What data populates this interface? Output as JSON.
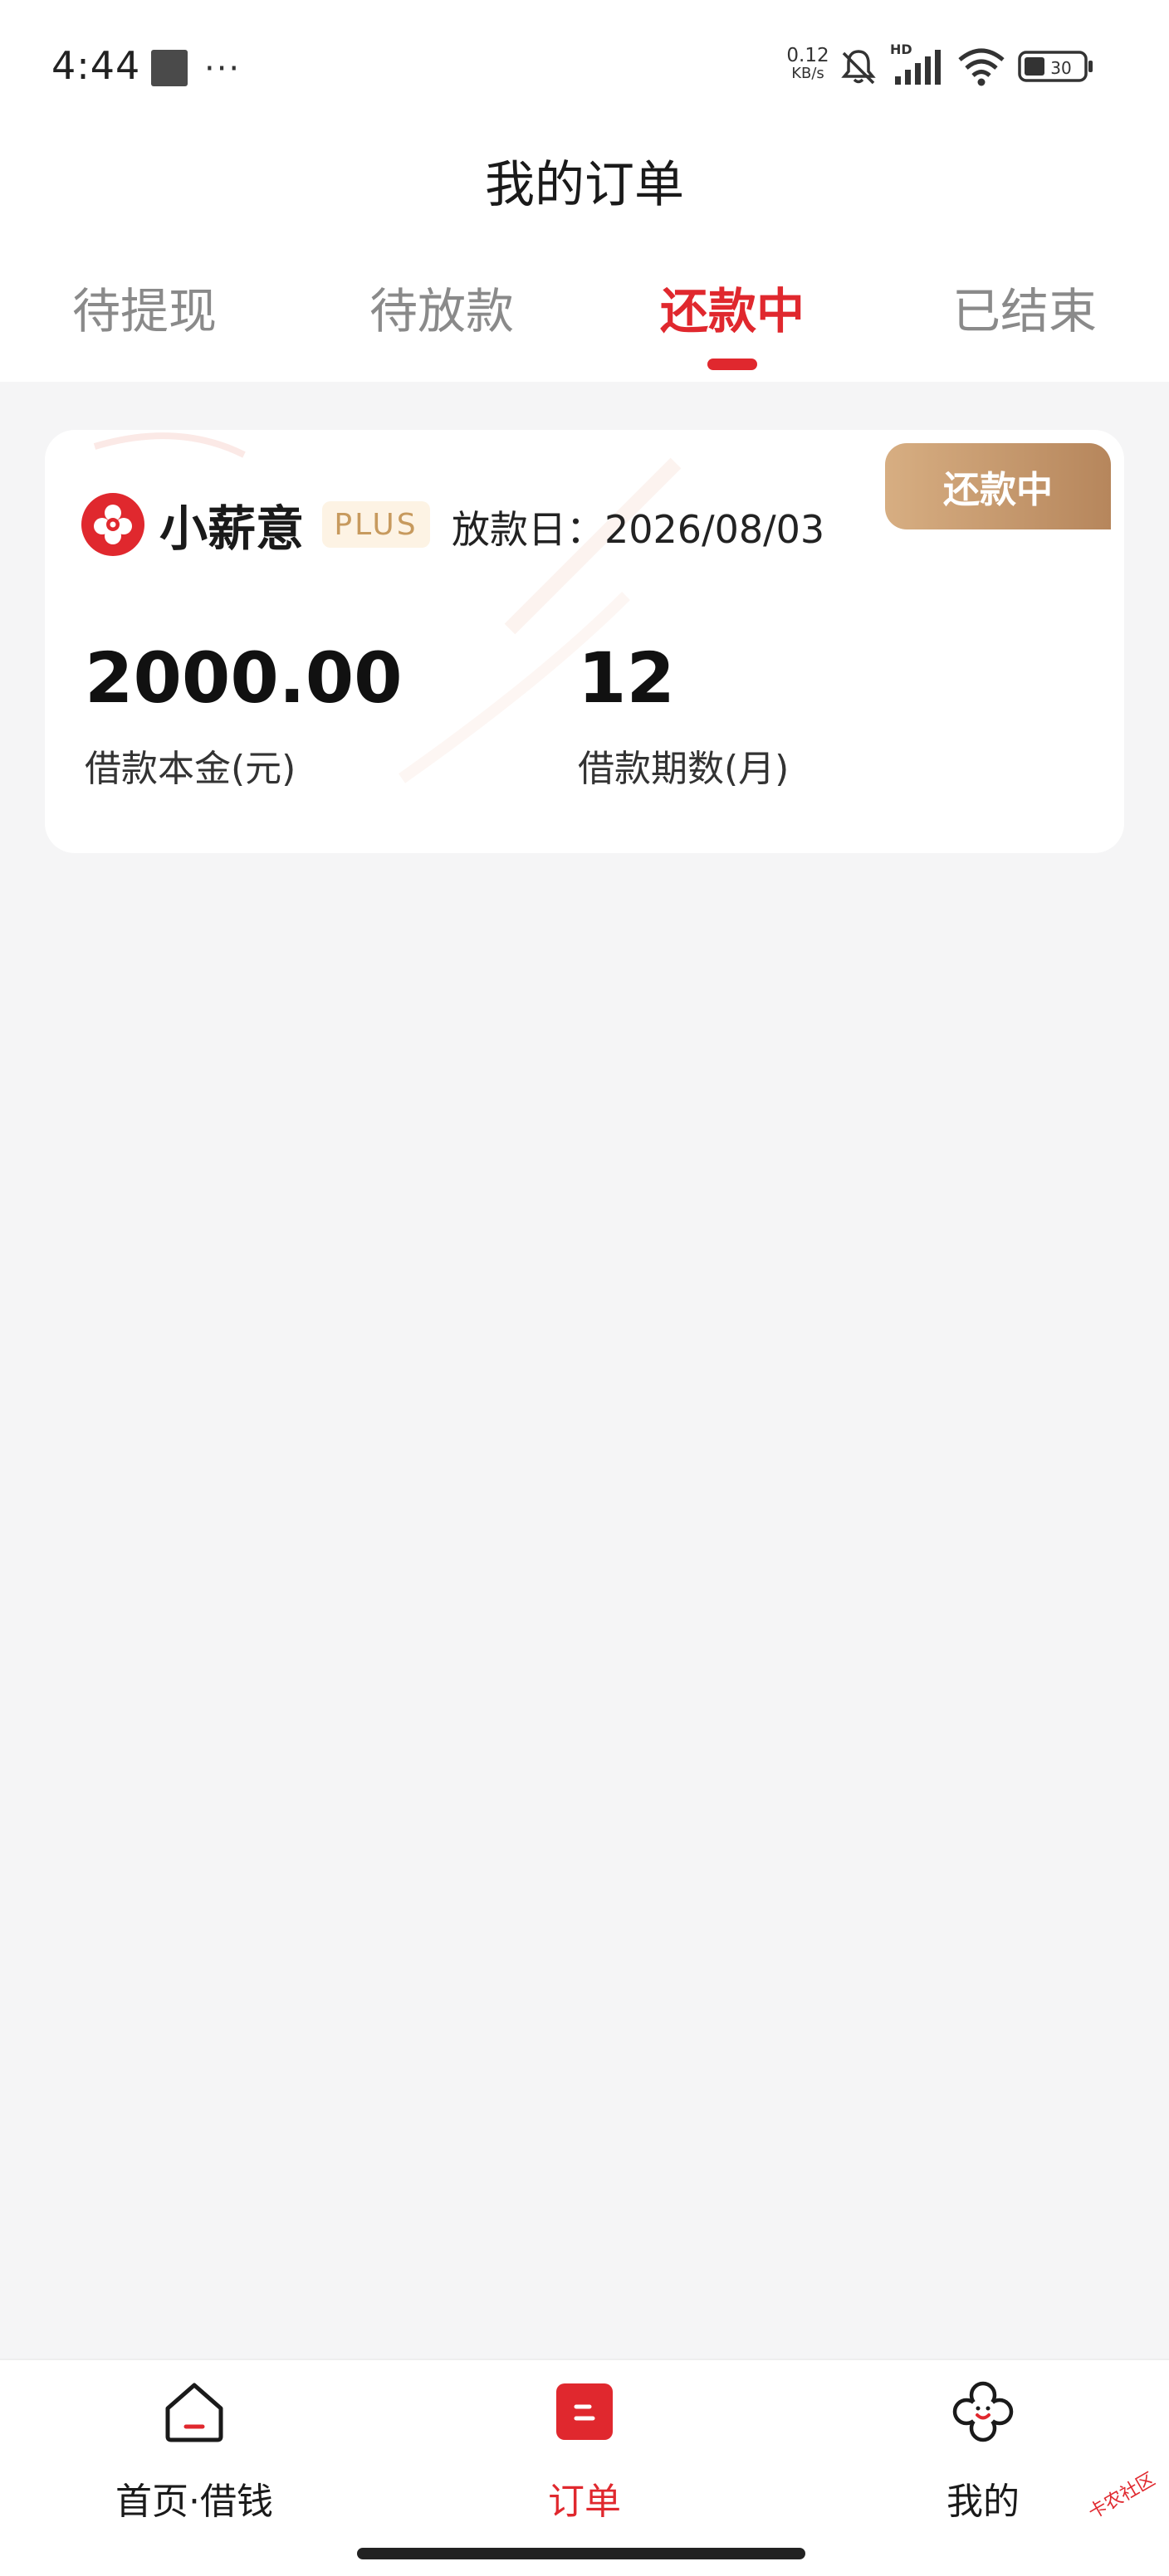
{
  "status_bar": {
    "time": "4:44",
    "dots": "···",
    "net_speed": "0.12",
    "net_unit": "KB/s",
    "network_type": "HD"
  },
  "header": {
    "title": "我的订单"
  },
  "tabs": [
    {
      "label": "待提现",
      "active": false
    },
    {
      "label": "待放款",
      "active": false
    },
    {
      "label": "还款中",
      "active": true
    },
    {
      "label": "已结束",
      "active": false
    }
  ],
  "order": {
    "status_tag": "还款中",
    "lender_name": "小薪意",
    "plus_badge": "PLUS",
    "loan_date": "放款日：2026/08/03",
    "amount": "2000.00",
    "amount_label": "借款本金(元)",
    "term": "12",
    "term_label": "借款期数(月)"
  },
  "bottom_nav": [
    {
      "label": "首页·借钱",
      "icon": "home-icon",
      "active": false
    },
    {
      "label": "订单",
      "icon": "order-icon",
      "active": true
    },
    {
      "label": "我的",
      "icon": "profile-flower-icon",
      "active": false
    }
  ],
  "watermark": "卡农社区",
  "colors": {
    "accent": "#e0282e",
    "tag_gold": "#c79a5e",
    "background": "#f5f5f6"
  }
}
